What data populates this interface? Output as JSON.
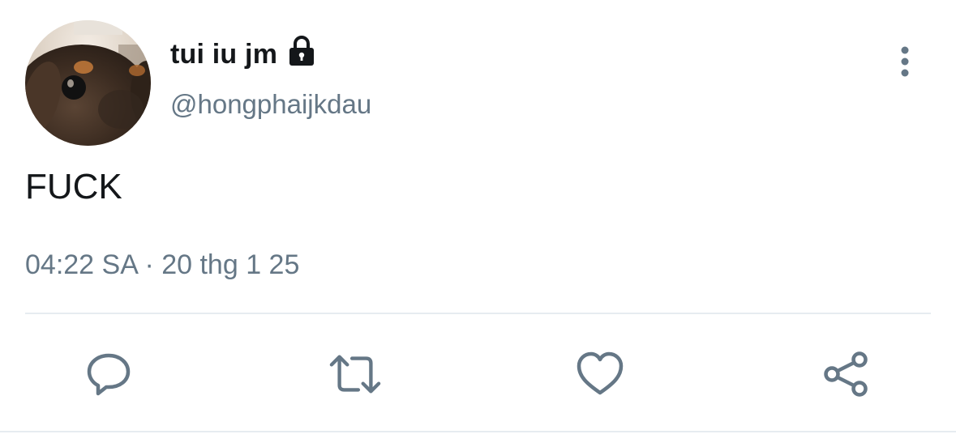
{
  "user": {
    "display_name": "tui iu jm",
    "handle": "@hongphaijkdau",
    "protected": true,
    "avatar_description": "close-up of a dog's face"
  },
  "tweet": {
    "text": "FUCK",
    "timestamp": "04:22 SA · 20 thg 1 25"
  },
  "icons": {
    "lock": "lock-icon",
    "more": "more-vertical-icon",
    "reply": "reply-icon",
    "retweet": "retweet-icon",
    "like": "heart-icon",
    "share": "share-icon"
  },
  "colors": {
    "text_primary": "#14171a",
    "text_secondary": "#657786",
    "icon": "#657786",
    "divider": "#e6ecf0"
  }
}
